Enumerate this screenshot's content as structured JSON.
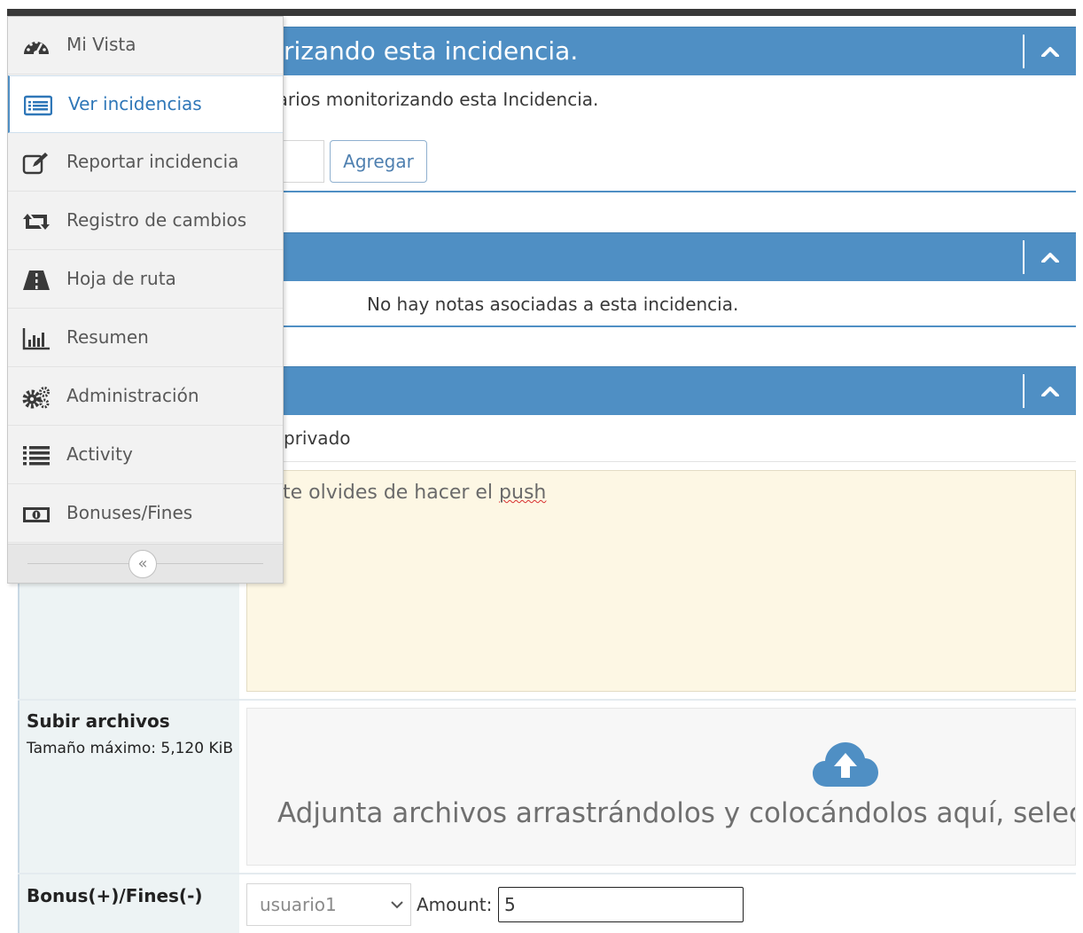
{
  "monitoring": {
    "title": "rizando esta incidencia.",
    "text": "uarios monitorizando esta Incidencia.",
    "input_value": "",
    "add_button": "Agregar"
  },
  "notes": {
    "empty_text": "No hay notas asociadas a esta incidencia."
  },
  "add_note": {
    "private_label": "privado",
    "note_text_before": "te olvides de hacer el ",
    "note_text_misspelled": "push",
    "upload_label": "Subir archivos",
    "upload_max": "Tamaño máximo: 5,120 KiB",
    "dropzone_text": "Adjunta archivos arrastrándolos y colocándolos aquí, selecci",
    "bonus_label": "Bonus(+)/Fines(-)",
    "user_select_value": "usuario1",
    "amount_label": "Amount:",
    "amount_value": "5"
  },
  "sidebar": {
    "items": [
      {
        "label": "Mi Vista",
        "icon": "dashboard-icon"
      },
      {
        "label": "Ver incidencias",
        "icon": "list-icon",
        "active": true
      },
      {
        "label": "Reportar incidencia",
        "icon": "edit-icon"
      },
      {
        "label": "Registro de cambios",
        "icon": "retweet-icon"
      },
      {
        "label": "Hoja de ruta",
        "icon": "road-icon"
      },
      {
        "label": "Resumen",
        "icon": "bar-chart-icon"
      },
      {
        "label": "Administración",
        "icon": "gears-icon"
      },
      {
        "label": "Activity",
        "icon": "list-lines-icon"
      },
      {
        "label": "Bonuses/Fines",
        "icon": "money-icon"
      }
    ],
    "collapse_glyph": "«"
  },
  "colors": {
    "accent": "#4f8fc4",
    "note_bg": "#fdf7e4",
    "dark_bar": "#393939"
  }
}
